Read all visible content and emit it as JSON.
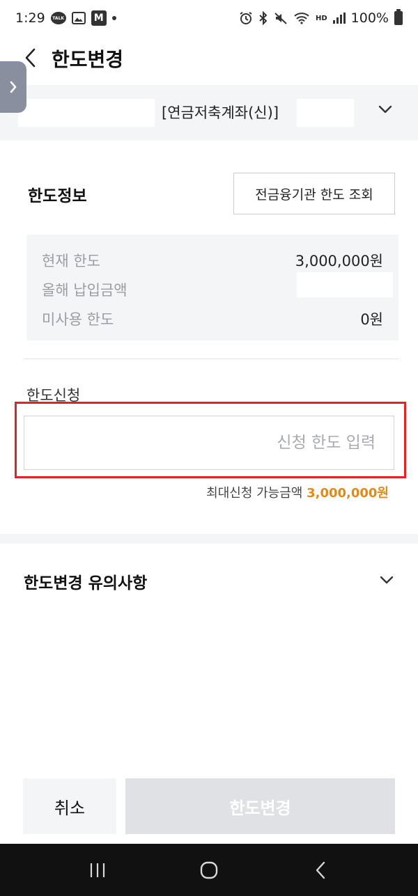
{
  "status_bar": {
    "time": "1:29",
    "talk_label": "TALK",
    "mstock_label": "M",
    "hd_label": "HD",
    "battery": "100%"
  },
  "header": {
    "title": "한도변경"
  },
  "account": {
    "name": "[연금저축계좌(신)]"
  },
  "limit_info": {
    "title": "한도정보",
    "query_button": "전금융기관 한도 조회",
    "rows": [
      {
        "label": "현재 한도",
        "value": "3,000,000원"
      },
      {
        "label": "올해 납입금액",
        "value": ""
      },
      {
        "label": "미사용 한도",
        "value": "0원"
      }
    ]
  },
  "request": {
    "label": "한도신청",
    "placeholder": "신청 한도 입력",
    "max_label": "최대신청 가능금액",
    "max_amount": "3,000,000원"
  },
  "notice": {
    "title": "한도변경 유의사항"
  },
  "buttons": {
    "cancel": "취소",
    "submit": "한도변경"
  },
  "colors": {
    "accent": "#e08a19",
    "highlight": "#e02424",
    "panel": "#f4f5f7",
    "disabled": "#dfe1e5"
  }
}
